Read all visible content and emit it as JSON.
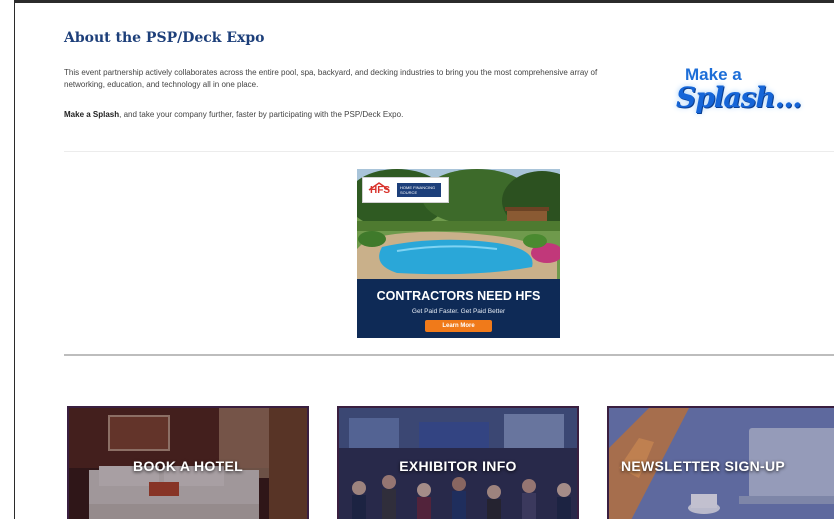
{
  "about": {
    "title": "About the PSP/Deck Expo",
    "paragraph1": "This event partnership actively collaborates across the entire pool, spa, backyard, and decking industries to bring you the most comprehensive array of networking, education, and technology all in one place.",
    "paragraph2_bold": "Make a Splash",
    "paragraph2_rest": ", and take your company further, faster by participating with the PSP/Deck Expo."
  },
  "splash_logo": {
    "line1": "Make a",
    "line2": "Splash..."
  },
  "ad": {
    "logo_text": "HFS",
    "logo_tagline": "HOME FINANCING SOURCE",
    "headline": "CONTRACTORS NEED HFS",
    "subline": "Get Paid Faster. Get Paid Better",
    "button_label": "Learn More"
  },
  "tiles": [
    {
      "label": "BOOK A HOTEL"
    },
    {
      "label": "EXHIBITOR INFO"
    },
    {
      "label": "NEWSLETTER SIGN-UP"
    }
  ],
  "colors": {
    "title_blue": "#1d3f7a",
    "splash_blue": "#1565d8",
    "ad_navy": "#0e2a56",
    "ad_button_orange": "#f07a1a",
    "tile_border": "#3a1f40"
  }
}
